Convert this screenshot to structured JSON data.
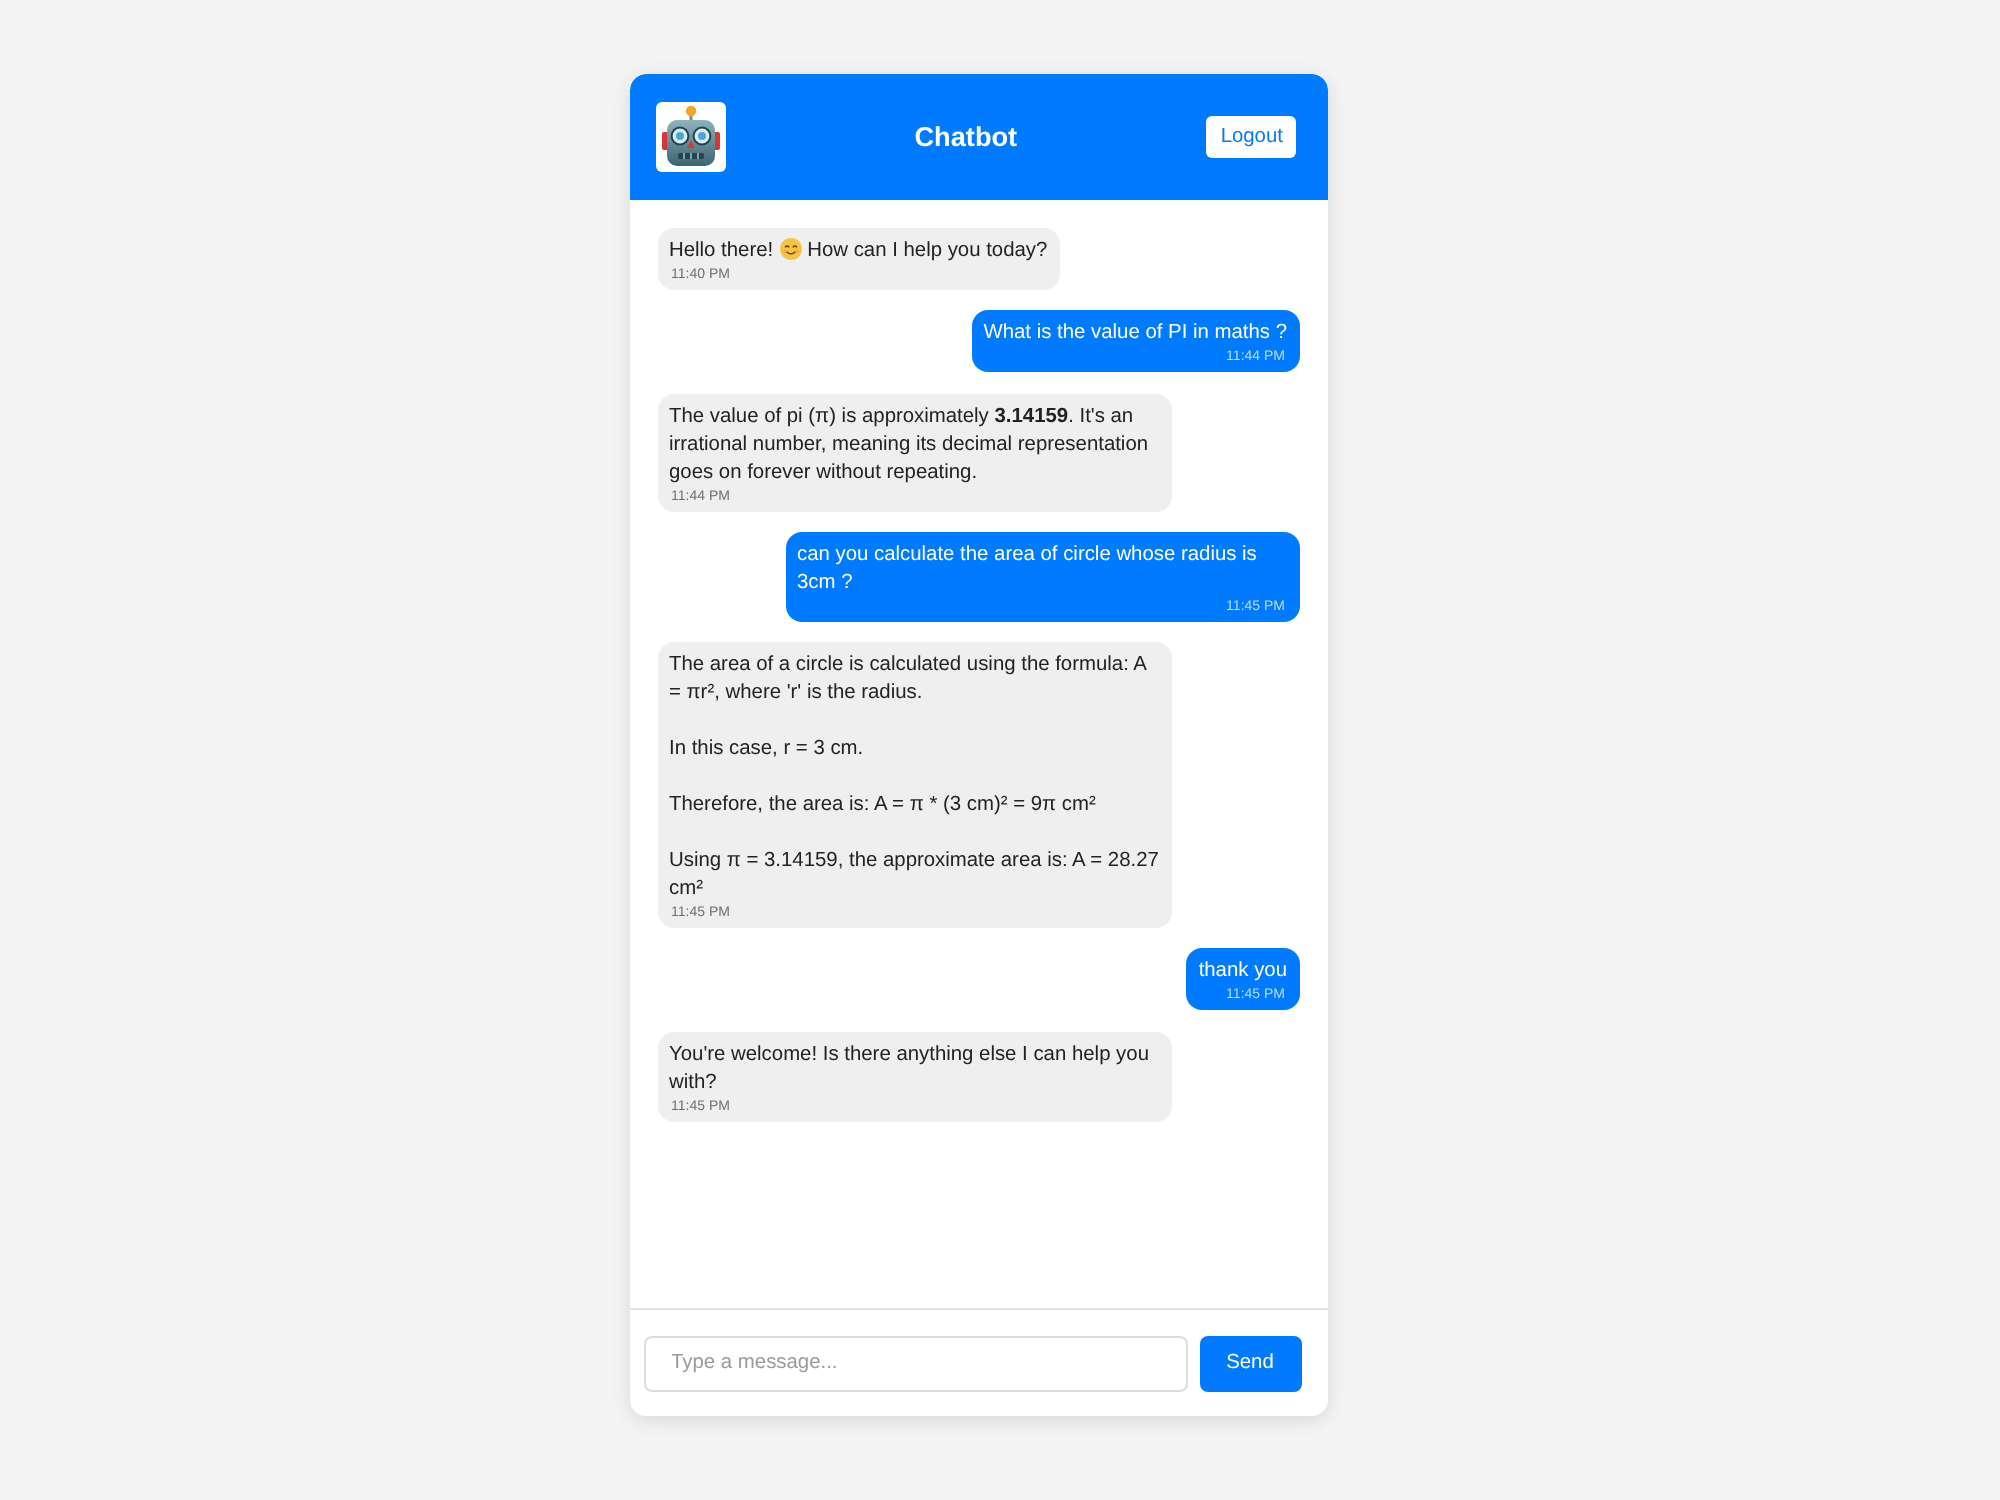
{
  "header": {
    "title": "Chatbot",
    "logout": "Logout"
  },
  "messages": [
    {
      "kind": "bot",
      "segments": [
        {
          "kind": "text",
          "text": "Hello there!"
        },
        {
          "kind": "emoji"
        },
        {
          "kind": "text",
          "text": "How can I help you today?"
        }
      ],
      "time": "11:40 PM"
    },
    {
      "kind": "user",
      "text": "What is the value of PI in maths ?",
      "time": "11:44 PM"
    },
    {
      "kind": "bot",
      "text": "The value of pi (π) is approximately **3.14159**. It's an irrational number, meaning its decimal representation goes on forever without repeating.",
      "time": "11:44 PM"
    },
    {
      "kind": "user",
      "text": "can you calculate the area of circle whose radius is 3cm ?",
      "time": "11:45 PM"
    },
    {
      "kind": "bot",
      "text": "The area of a circle is calculated using the formula: A = πr², where 'r' is the radius.\n\nIn this case, r = 3 cm.\n\nTherefore, the area is: A = π * (3 cm)² = 9π cm²\n\nUsing π = 3.14159, the approximate area is: A = 28.27 cm²",
      "time": "11:45 PM"
    },
    {
      "kind": "user",
      "text": "thank you",
      "time": "11:45 PM"
    },
    {
      "kind": "bot",
      "text": "You're welcome! Is there anything else I can help you with?",
      "time": "11:45 PM"
    }
  ],
  "composer": {
    "placeholder": "Type a message...",
    "send": "Send"
  }
}
